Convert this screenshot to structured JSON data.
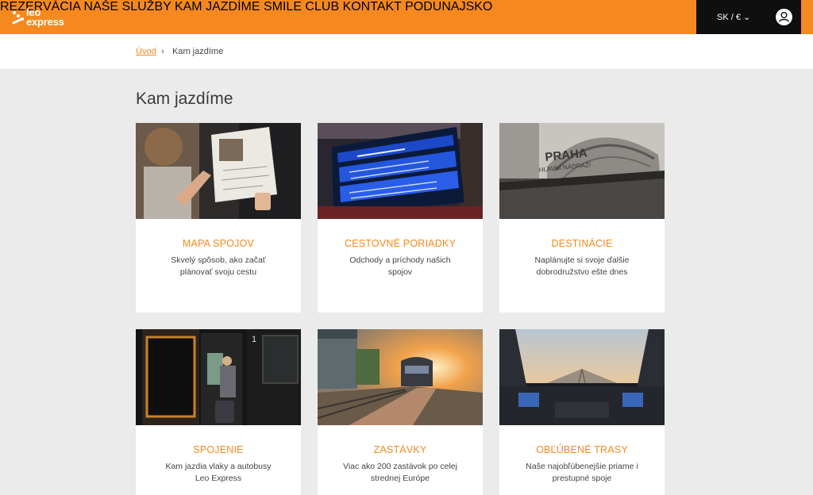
{
  "brand": {
    "line1": "leo",
    "line2": "express"
  },
  "nav": [
    "REZERVÁCIA",
    "NAŠE SLUŽBY",
    "KAM JAZDÍME",
    "SMILE CLUB",
    "KONTAKT",
    "PODUNAJSKO"
  ],
  "language": "SK / € ⌄",
  "breadcrumb": {
    "home": "Úvod",
    "separator": "›",
    "current": "Kam jazdíme"
  },
  "page_title": "Kam jazdíme",
  "cards": [
    {
      "title": "MAPA SPOJOV",
      "description": "Skvelý spôsob, ako začať plánovať svoju cestu",
      "image": "woman-reading-map"
    },
    {
      "title": "CESTOVNÉ PORIADKY",
      "description": "Odchody a príchody našich spojov",
      "image": "departure-board"
    },
    {
      "title": "DESTINÁCIE",
      "description": "Naplánujte si svoje ďalšie dobrodružstvo ešte dnes",
      "image": "praha-station"
    },
    {
      "title": "SPOJENIE",
      "description": "Kam jazdia vlaky a autobusy Leo Express",
      "image": "train-door"
    },
    {
      "title": "ZASTÁVKY",
      "description": "Viac ako 200 zastávok po celej strednej Európe",
      "image": "train-platform-sunset"
    },
    {
      "title": "OBĽÚBENÉ TRASY",
      "description": "Naše najobľúbenejšie priame i prestupné spoje",
      "image": "train-cabin"
    }
  ],
  "colors": {
    "accent": "#f5891f",
    "dark": "#0f0f0f",
    "background": "#ebebeb"
  }
}
